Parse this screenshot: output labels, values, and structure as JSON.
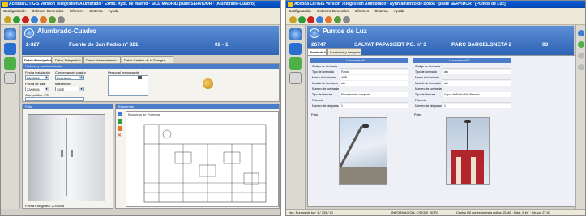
{
  "left": {
    "window_title": "Aceboa CITIGIS Versión Telegestión Alumbrado · Exmo. Ayto. de Madrid · SICL MADRID paste SERVIDOR · [Alumbrado-Cuadro]",
    "menu": [
      "Configuración",
      "Ordenes Generales",
      "Informes",
      "Sistema",
      "Ayuda"
    ],
    "header": {
      "title": "Alumbrado-Cuadro",
      "id": "2-327",
      "name": "Fuente de San Pedro nº 321",
      "code": "02 - 1"
    },
    "tabs": [
      "Datos Principales",
      "Datos Telegestión",
      "Datos Mantenimiento",
      "Datos Gestión de la Energía"
    ],
    "section_title": "Historial y mantenimiento",
    "form": {
      "fecha_instalacion_label": "Fecha instalación",
      "fecha_instalacion": "23/05/06",
      "conservacion_label": "Conservación cuadro",
      "conservacion": "Excelente",
      "fecha_alta_label": "Fecha de alta",
      "fecha_alta": "23/05/06",
      "mantenido_label": "Mantenido",
      "mantenido": "SICE",
      "campo_libre_label": "Campo libre nº3",
      "personal_label": "Personal responsable"
    },
    "photo_panel_title": "Foto",
    "photo_caption": "Fecha Fotografía: 27/06/06",
    "scheme_panel_title": "Esquemas",
    "scheme_title": "Esquema de Potencia"
  },
  "right": {
    "window_title": "Aceboa CITIGIS Versión Telegestión Alumbrado · Ayuntamiento de Boroa · paste SERVIDOR · [Puntos de Luz]",
    "menu": [
      "Configuración",
      "Ordenes Generales",
      "Informes",
      "Sistema",
      "Ayuda"
    ],
    "header": {
      "title": "Puntos de Luz",
      "id": "26747",
      "street": "SALVAT PAPASSEIT PG. nº 3",
      "zone": "PARC BARCELONETA 2",
      "code": "03"
    },
    "tabs": [
      "Punto de luz",
      "Luminaria y Lámpara"
    ],
    "lum1_title": "Luminaria nº 1",
    "lum2_title": "Luminaria nº 2",
    "fields": [
      {
        "k": "Código de luminaria",
        "v1": "",
        "v2": ""
      },
      {
        "k": "Tipo de luminaria",
        "v1": "Farola",
        "v2": "ato"
      },
      {
        "k": "Marca de luminaria",
        "v1": "APP",
        "v2": ""
      },
      {
        "k": "Modelo de luminaria",
        "v1": "ato",
        "v2": "ato"
      },
      {
        "k": "Número de luminarias",
        "v1": "",
        "v2": ""
      },
      {
        "k": "Tipo de lámpara",
        "v1": "Fluorescente compacta",
        "v2": "Vapor de Sodio Alta Presión"
      },
      {
        "k": "Potencia",
        "v1": "",
        "v2": ""
      },
      {
        "k": "Número de lámparas",
        "v1": "1",
        "v2": "1"
      }
    ],
    "photo_label": "Foto",
    "status_left": "Nro. Puntos de luz: 1 / 733 / 01",
    "status_mid": "INFORMACION: CITIGIS_BOR3",
    "status_right": "Centro IBI conexión esta activa: 21:46  ·  Distr. 8 kV · Grupo: 27:03"
  }
}
